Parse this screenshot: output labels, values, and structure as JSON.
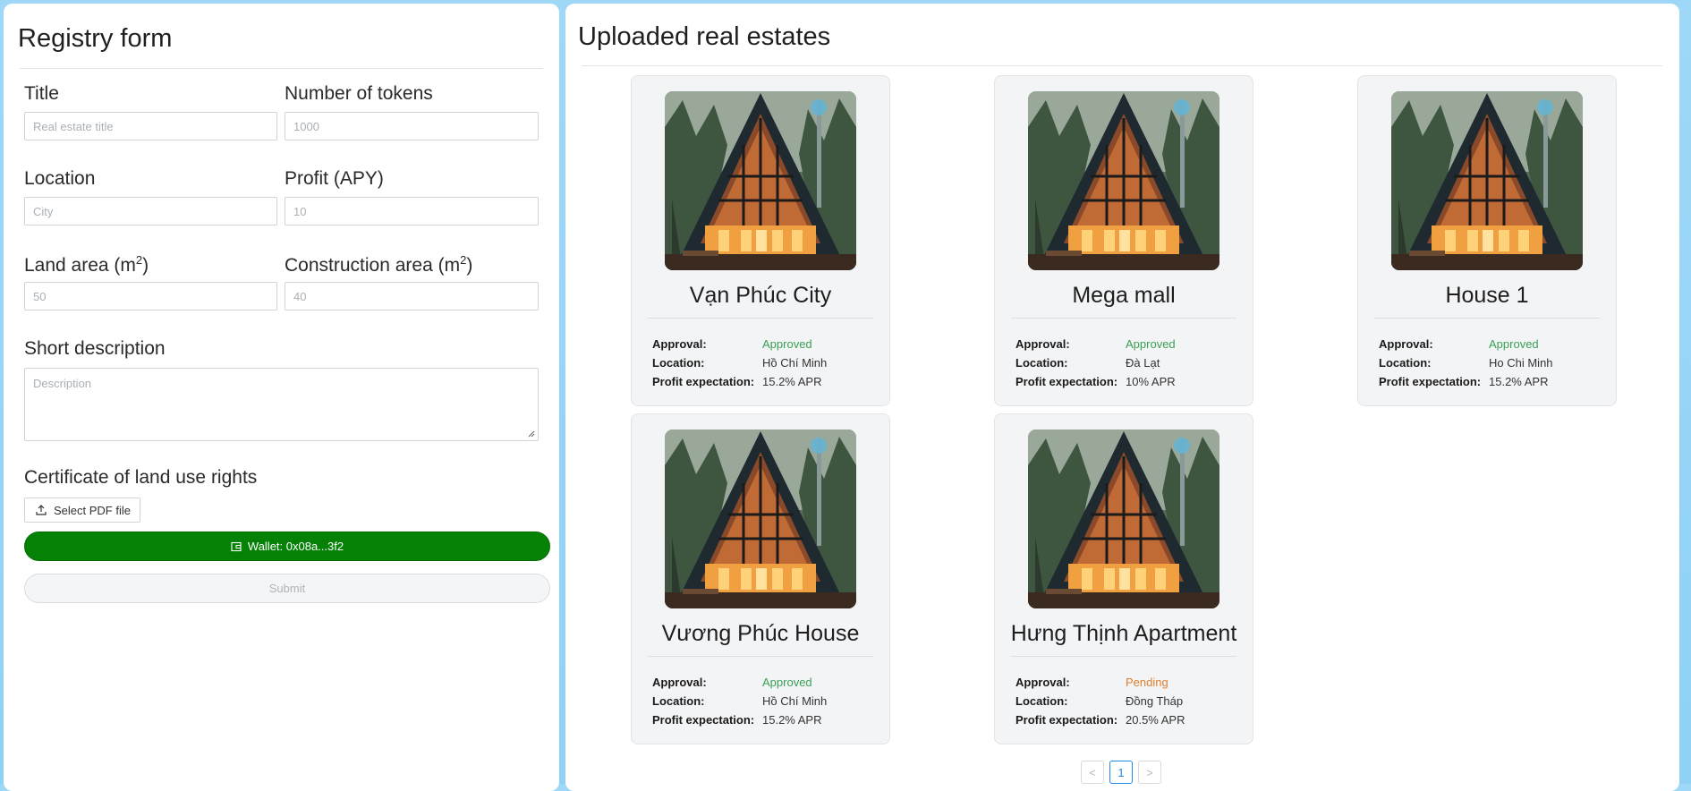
{
  "form": {
    "title": "Registry form",
    "fields": {
      "title_label": "Title",
      "title_placeholder": "Real estate title",
      "tokens_label": "Number of tokens",
      "tokens_placeholder": "1000",
      "location_label": "Location",
      "location_placeholder": "City",
      "profit_label": "Profit (APY)",
      "profit_placeholder": "10",
      "land_label": "Land area (m",
      "land_sup": "2",
      "land_close": ")",
      "land_placeholder": "50",
      "construction_label": "Construction area (m",
      "construction_sup": "2",
      "construction_close": ")",
      "construction_placeholder": "40",
      "desc_label": "Short description",
      "desc_placeholder": "Description",
      "cert_label": "Certificate of land use rights"
    },
    "file_button": "Select PDF file",
    "wallet_button": "Wallet: 0x08a...3f2",
    "submit_button": "Submit",
    "colors": {
      "wallet_green": "#058205"
    }
  },
  "listing": {
    "title": "Uploaded real estates",
    "labels": {
      "approval": "Approval:",
      "location": "Location:",
      "profit": "Profit expectation:"
    },
    "cards": [
      {
        "name": "Vạn Phúc City",
        "approval": "Approved",
        "location": "Hồ Chí Minh",
        "profit": "15.2% APR"
      },
      {
        "name": "Mega mall",
        "approval": "Approved",
        "location": "Đà Lạt",
        "profit": "10% APR"
      },
      {
        "name": "House 1",
        "approval": "Approved",
        "location": "Ho Chi Minh",
        "profit": "15.2% APR"
      },
      {
        "name": "Vương Phúc House",
        "approval": "Approved",
        "location": "Hồ Chí Minh",
        "profit": "15.2% APR"
      },
      {
        "name": "Hưng Thịnh Apartment",
        "approval": "Pending",
        "location": "Đồng Tháp",
        "profit": "20.5% APR"
      }
    ],
    "pagination": {
      "prev": "<",
      "current": "1",
      "next": ">"
    }
  }
}
